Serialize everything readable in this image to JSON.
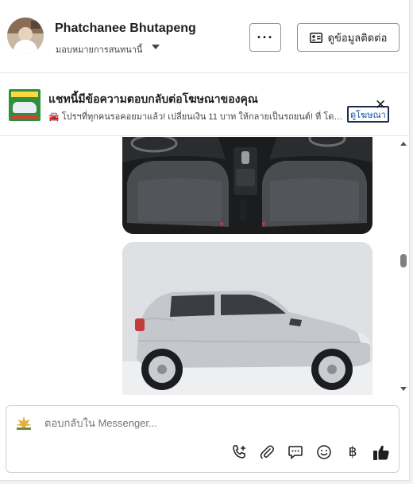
{
  "header": {
    "name": "Phatchanee Bhutapeng",
    "assign_label": "มอบหมายการสนทนานี้",
    "more_label": "···",
    "contact_label": "ดูข้อมูลติดต่อ"
  },
  "ad_banner": {
    "title": "แชทนี้มีข้อความตอบกลับต่อโฆษณาของคุณ",
    "text": "🚘 โปรฯที่ทุกคนรอคอยมาแล้ว! เปลี่ยนเงิน 11 บาท ให้กลายเป็นรถยนต์! ที่ โดยทีมงานมืออาชีพ",
    "view_ad_label": "ดูโฆษณา",
    "close_label": "✕"
  },
  "composer": {
    "placeholder": "ตอบกลับใน Messenger...",
    "baht_label": "฿"
  },
  "colors": {
    "accent": "#1c2b4a",
    "link": "#0a4fa6",
    "border": "#ccd0d5",
    "car_body": "#c4c8cd"
  }
}
